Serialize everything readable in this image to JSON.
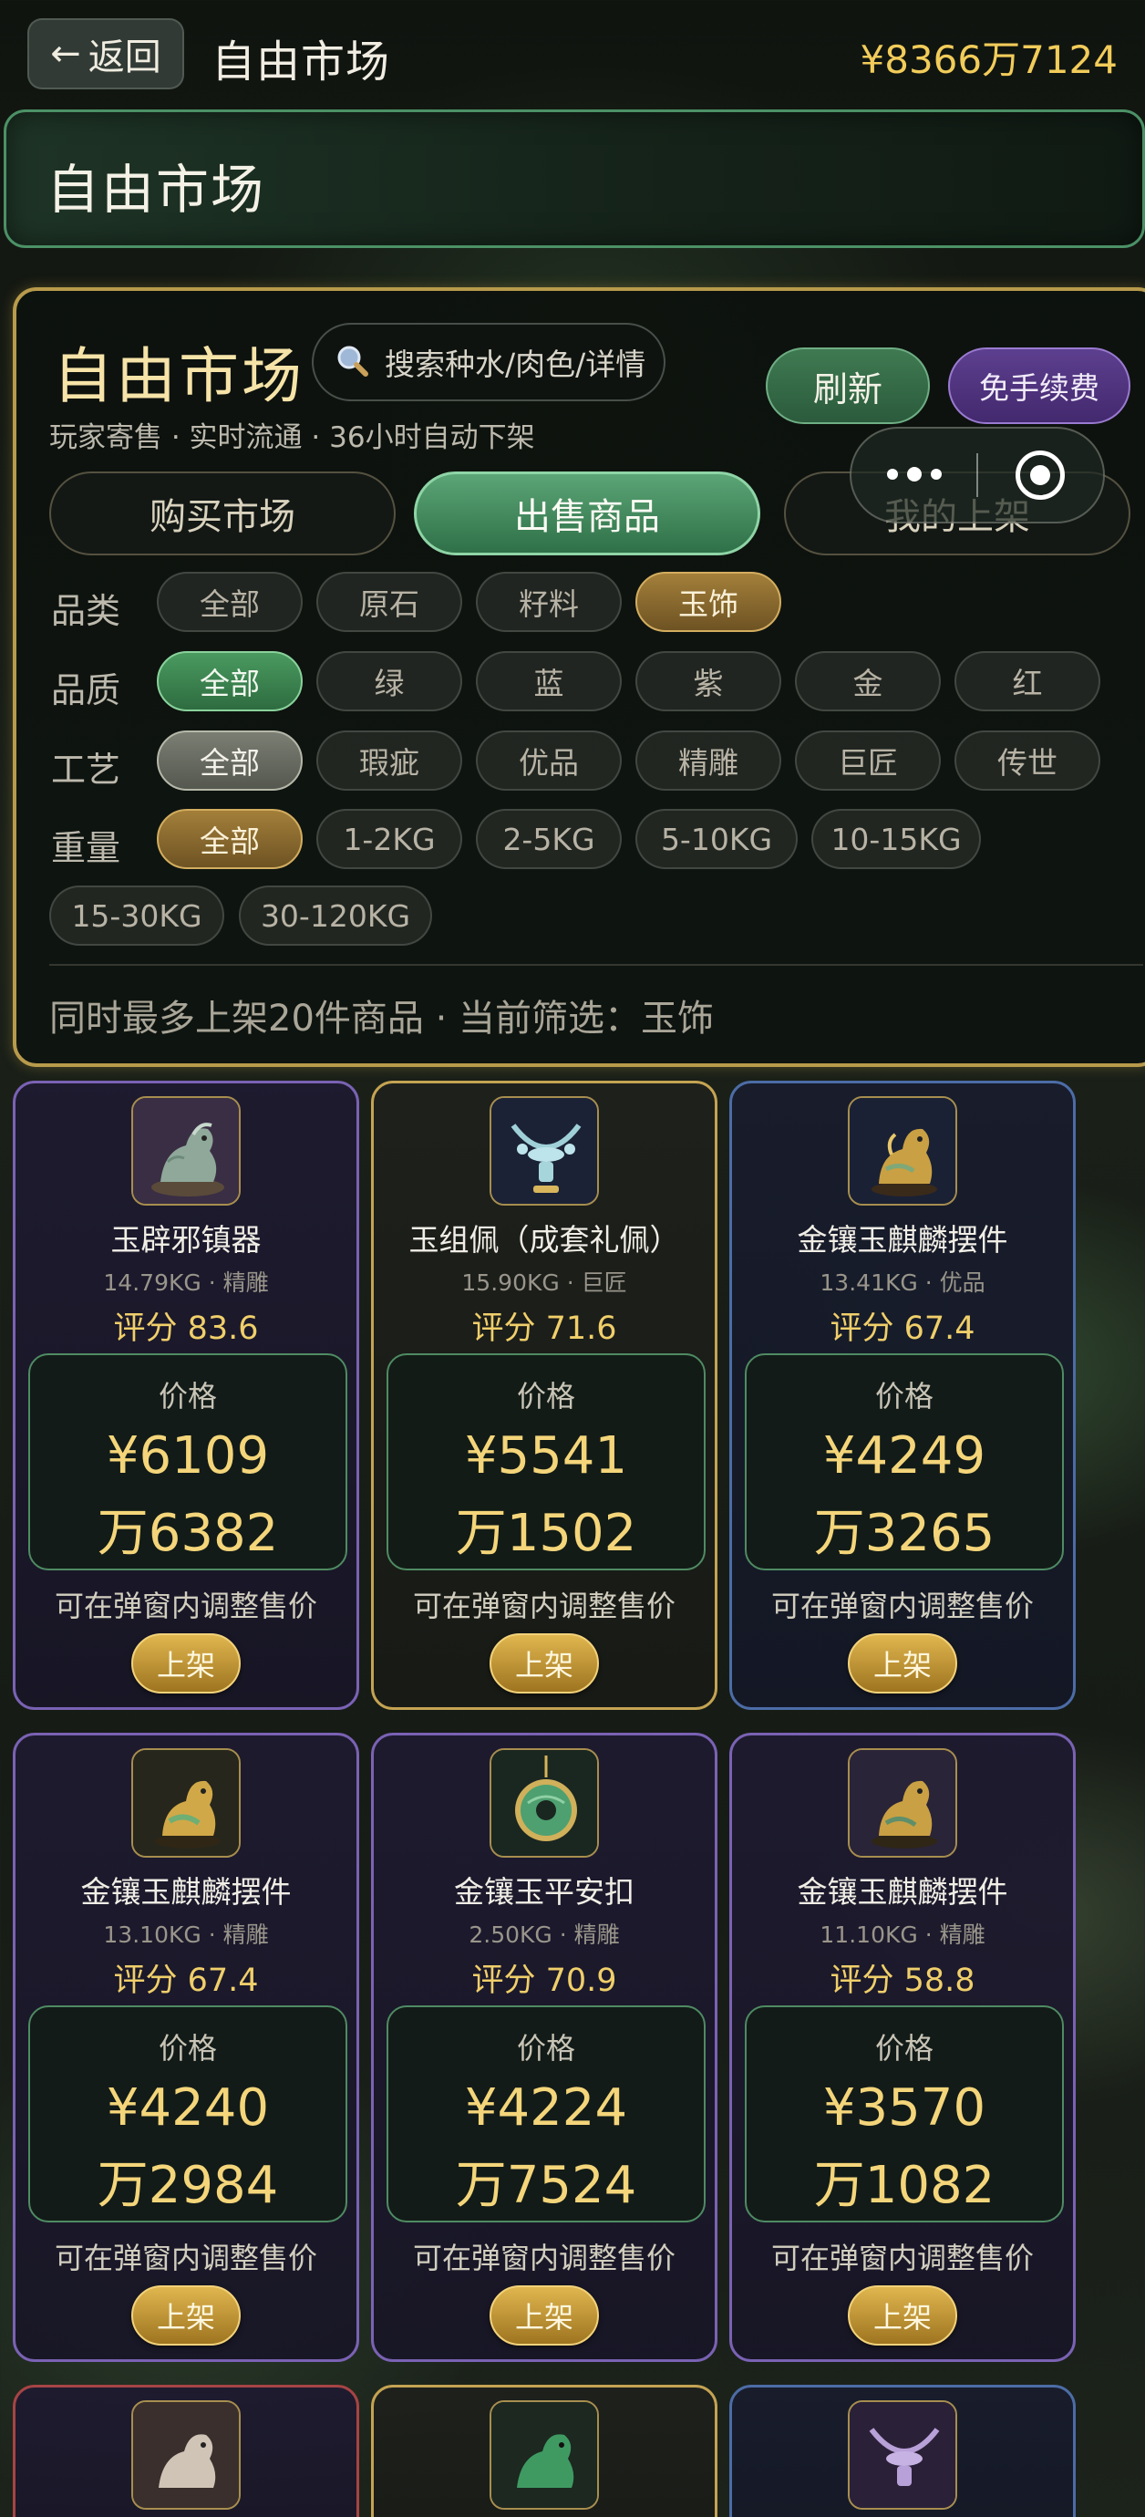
{
  "topbar": {
    "back_label": "返回",
    "title": "自由市场",
    "balance": "¥8366万7124"
  },
  "banner": {
    "title": "自由市场"
  },
  "panel": {
    "title": "自由市场",
    "search_placeholder": "搜索种水/肉色/详情",
    "refresh_label": "刷新",
    "no_fee_label": "免手续费",
    "subtitle": "玩家寄售 · 实时流通 · 36小时自动下架",
    "tabs": [
      {
        "label": "购买市场"
      },
      {
        "label": "出售商品"
      },
      {
        "label": "我的上架"
      }
    ],
    "active_tab": "出售商品",
    "filters": {
      "category": {
        "label": "品类",
        "options": [
          "全部",
          "原石",
          "籽料",
          "玉饰"
        ],
        "selected": "玉饰"
      },
      "quality": {
        "label": "品质",
        "options": [
          "全部",
          "绿",
          "蓝",
          "紫",
          "金",
          "红"
        ],
        "selected": "全部"
      },
      "craft": {
        "label": "工艺",
        "options": [
          "全部",
          "瑕疵",
          "优品",
          "精雕",
          "巨匠",
          "传世"
        ],
        "selected": "全部"
      },
      "weight": {
        "label": "重量",
        "options": [
          "全部",
          "1-2KG",
          "2-5KG",
          "5-10KG",
          "10-15KG",
          "15-30KG",
          "30-120KG"
        ],
        "selected": "全部"
      }
    },
    "note": "同时最多上架20件商品 · 当前筛选：玉饰"
  },
  "cards": [
    {
      "name": "玉辟邪镇器",
      "meta": "14.79KG · 精雕",
      "score": "评分 83.6",
      "price_label": "价格",
      "price_1": "¥6109",
      "price_2": "万6382",
      "hint": "可在弹窗内调整售价",
      "button": "上架",
      "rarity": "purple",
      "rarity_color": "#7a62b4"
    },
    {
      "name": "玉组佩（成套礼佩）",
      "meta": "15.90KG · 巨匠",
      "score": "评分 71.6",
      "price_label": "价格",
      "price_1": "¥5541",
      "price_2": "万1502",
      "hint": "可在弹窗内调整售价",
      "button": "上架",
      "rarity": "gold",
      "rarity_color": "#c4a352"
    },
    {
      "name": "金镶玉麒麟摆件",
      "meta": "13.41KG · 优品",
      "score": "评分 67.4",
      "price_label": "价格",
      "price_1": "¥4249",
      "price_2": "万3265",
      "hint": "可在弹窗内调整售价",
      "button": "上架",
      "rarity": "blue",
      "rarity_color": "#4c6ca6"
    },
    {
      "name": "金镶玉麒麟摆件",
      "meta": "13.10KG · 精雕",
      "score": "评分 67.4",
      "price_label": "价格",
      "price_1": "¥4240",
      "price_2": "万2984",
      "hint": "可在弹窗内调整售价",
      "button": "上架",
      "rarity": "purple",
      "rarity_color": "#7a62b4"
    },
    {
      "name": "金镶玉平安扣",
      "meta": "2.50KG · 精雕",
      "score": "评分 70.9",
      "price_label": "价格",
      "price_1": "¥4224",
      "price_2": "万7524",
      "hint": "可在弹窗内调整售价",
      "button": "上架",
      "rarity": "purple",
      "rarity_color": "#7a62b4"
    },
    {
      "name": "金镶玉麒麟摆件",
      "meta": "11.10KG · 精雕",
      "score": "评分 58.8",
      "price_label": "价格",
      "price_1": "¥3570",
      "price_2": "万1082",
      "hint": "可在弹窗内调整售价",
      "button": "上架",
      "rarity": "purple",
      "rarity_color": "#7a62b4"
    }
  ],
  "colors": {
    "accent_gold": "#f2cc5a",
    "accent_green": "#4c9166",
    "panel_border": "#b79a4b"
  }
}
